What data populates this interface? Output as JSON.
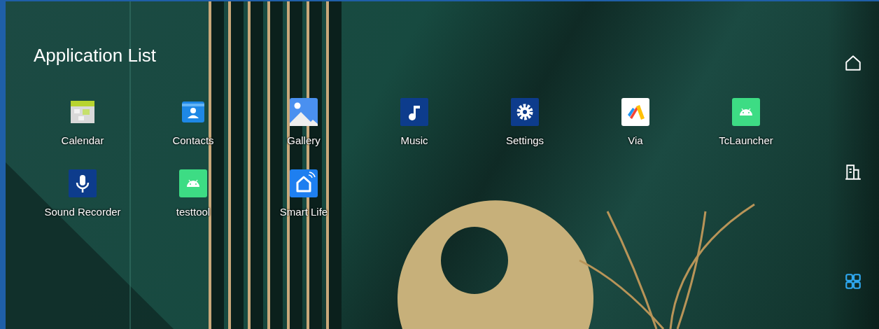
{
  "title": "Application List",
  "apps": [
    {
      "label": "Calendar",
      "kind": "calendar"
    },
    {
      "label": "Contacts",
      "kind": "contacts"
    },
    {
      "label": "Gallery",
      "kind": "gallery"
    },
    {
      "label": "Music",
      "kind": "music"
    },
    {
      "label": "Settings",
      "kind": "settings"
    },
    {
      "label": "Via",
      "kind": "via"
    },
    {
      "label": "TcLauncher",
      "kind": "android"
    },
    {
      "label": "Sound Recorder",
      "kind": "recorder"
    },
    {
      "label": "testtool",
      "kind": "android"
    },
    {
      "label": "Smart Life",
      "kind": "smarthome"
    }
  ],
  "nav": [
    {
      "kind": "home",
      "selected": false
    },
    {
      "kind": "building",
      "selected": false
    },
    {
      "kind": "apps",
      "selected": true
    }
  ]
}
